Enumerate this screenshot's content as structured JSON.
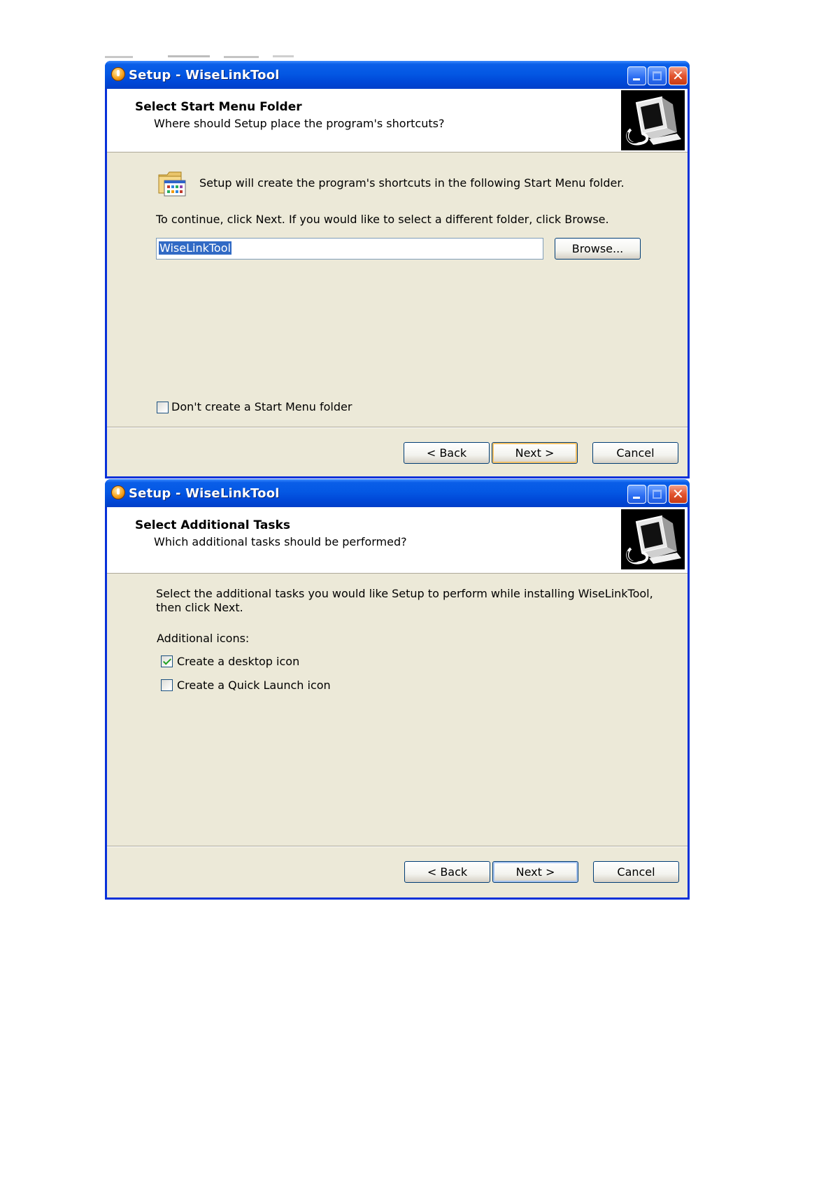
{
  "windows": [
    {
      "title": "Setup - WiseLinkTool",
      "header": {
        "title": "Select Start Menu Folder",
        "subtitle": "Where should Setup place the program's shortcuts?"
      },
      "info_text": "Setup will create the program's shortcuts in the following Start Menu folder.",
      "instruction": "To continue, click Next. If you would like to select a different folder, click Browse.",
      "folder_field": {
        "value": "WiseLinkTool"
      },
      "browse_label": "Browse...",
      "no_folder_checkbox": {
        "label": "Don't create a Start Menu folder",
        "checked": false
      },
      "buttons": {
        "back": "< Back",
        "next": "Next >",
        "cancel": "Cancel"
      }
    },
    {
      "title": "Setup - WiseLinkTool",
      "header": {
        "title": "Select Additional Tasks",
        "subtitle": "Which additional tasks should be performed?"
      },
      "intro_line1": "Select the additional tasks you would like Setup to perform while installing WiseLinkTool,",
      "intro_line2": "then click Next.",
      "group_label": "Additional icons:",
      "tasks": [
        {
          "label": "Create a desktop icon",
          "checked": true
        },
        {
          "label": "Create a Quick Launch icon",
          "checked": false
        }
      ],
      "buttons": {
        "back": "< Back",
        "next": "Next >",
        "cancel": "Cancel"
      }
    }
  ],
  "colors": {
    "titlebar": "#0458e4",
    "window_border": "#0831d9",
    "dialog_bg": "#ece9d8",
    "selection": "#316ac5"
  },
  "icons": [
    "setup-app-icon",
    "minimize-icon",
    "maximize-icon",
    "close-icon",
    "installer-computer-icon",
    "start-menu-folder-icon",
    "checkmark-icon"
  ]
}
